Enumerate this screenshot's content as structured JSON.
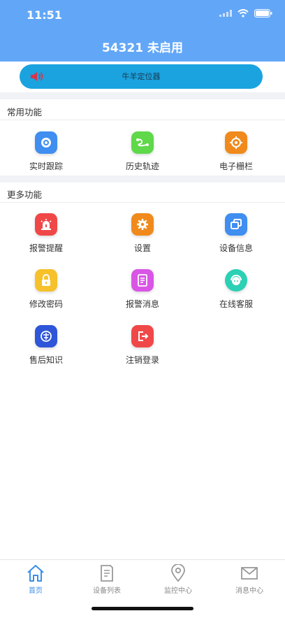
{
  "status": {
    "time": "11:51"
  },
  "header": {
    "title": "54321 未启用"
  },
  "notice": {
    "text": "牛羊定位器"
  },
  "common": {
    "title": "常用功能",
    "items": [
      {
        "label": "实时跟踪",
        "icon": "location-target-icon",
        "color": "#3f8ef0"
      },
      {
        "label": "历史轨迹",
        "icon": "route-icon",
        "color": "#5fd84a"
      },
      {
        "label": "电子栅栏",
        "icon": "crosshair-icon",
        "color": "#f08a1c"
      }
    ]
  },
  "more": {
    "title": "更多功能",
    "items": [
      {
        "label": "报警提醒",
        "icon": "alarm-light-icon",
        "color": "#f04848"
      },
      {
        "label": "设置",
        "icon": "gear-icon",
        "color": "#f08a1c"
      },
      {
        "label": "设备信息",
        "icon": "device-windows-icon",
        "color": "#3f8ef0"
      },
      {
        "label": "修改密码",
        "icon": "lock-icon",
        "color": "#f6c12a"
      },
      {
        "label": "报警消息",
        "icon": "document-icon",
        "color": "#d955e6"
      },
      {
        "label": "在线客服",
        "icon": "customer-service-icon",
        "color": "#2bd0b5"
      },
      {
        "label": "售后知识",
        "icon": "after-sales-icon",
        "color": "#2f55d8"
      },
      {
        "label": "注销登录",
        "icon": "logout-icon",
        "color": "#f04848"
      }
    ]
  },
  "tabs": [
    {
      "label": "首页",
      "icon": "home-icon",
      "active": true
    },
    {
      "label": "设备列表",
      "icon": "device-list-icon",
      "active": false
    },
    {
      "label": "监控中心",
      "icon": "map-pin-icon",
      "active": false
    },
    {
      "label": "消息中心",
      "icon": "mail-icon",
      "active": false
    }
  ],
  "colors": {
    "header": "#62a7f7",
    "notice": "#1aa3df",
    "active_tab": "#3a8ee6"
  }
}
